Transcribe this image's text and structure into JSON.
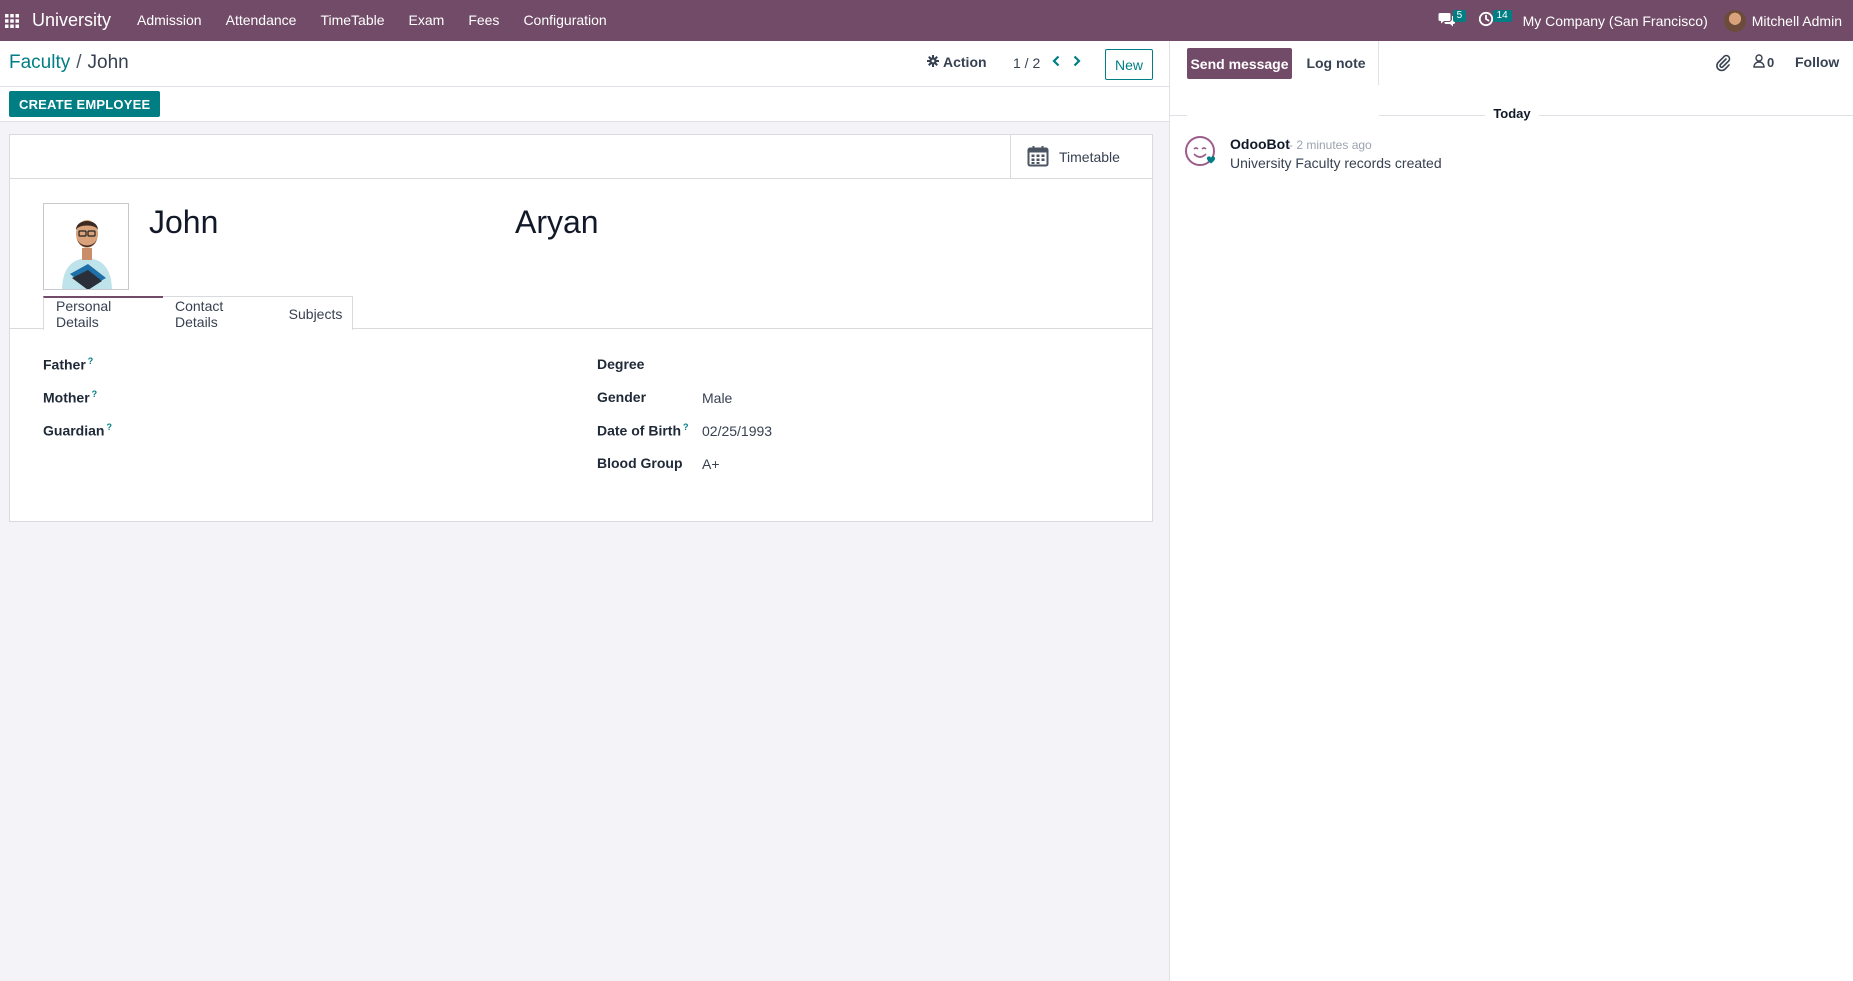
{
  "navbar": {
    "brand": "University",
    "menu": [
      "Admission",
      "Attendance",
      "TimeTable",
      "Exam",
      "Fees",
      "Configuration"
    ],
    "messages_count": "5",
    "activities_count": "14",
    "company": "My Company (San Francisco)",
    "user": "Mitchell Admin"
  },
  "control_panel": {
    "breadcrumb_parent": "Faculty",
    "breadcrumb_separator": "/",
    "breadcrumb_current": "John",
    "action_label": "Action",
    "pager": "1 / 2",
    "new_label": "New"
  },
  "statusbar": {
    "create_employee_label": "CREATE EMPLOYEE"
  },
  "form": {
    "stat_button_label": "Timetable",
    "first_name": "John",
    "last_name": "Aryan",
    "tabs": [
      "Personal Details",
      "Contact Details",
      "Subjects"
    ],
    "left_fields": [
      {
        "label": "Father",
        "help": "?",
        "value": ""
      },
      {
        "label": "Mother",
        "help": "?",
        "value": ""
      },
      {
        "label": "Guardian",
        "help": "?",
        "value": ""
      }
    ],
    "right_fields": [
      {
        "label": "Degree",
        "help": "",
        "value": ""
      },
      {
        "label": "Gender",
        "help": "",
        "value": "Male"
      },
      {
        "label": "Date of Birth",
        "help": "?",
        "value": "02/25/1993"
      },
      {
        "label": "Blood Group",
        "help": "",
        "value": "A+"
      }
    ]
  },
  "chatter": {
    "send_message_label": "Send message",
    "log_note_label": "Log note",
    "followers_count": "0",
    "follow_label": "Follow",
    "date_separator": "Today",
    "message": {
      "author": "OdooBot",
      "date": "- 2 minutes ago",
      "body": "University Faculty records created"
    }
  },
  "colors": {
    "navbar": "#714B67",
    "accent": "#017e84"
  }
}
